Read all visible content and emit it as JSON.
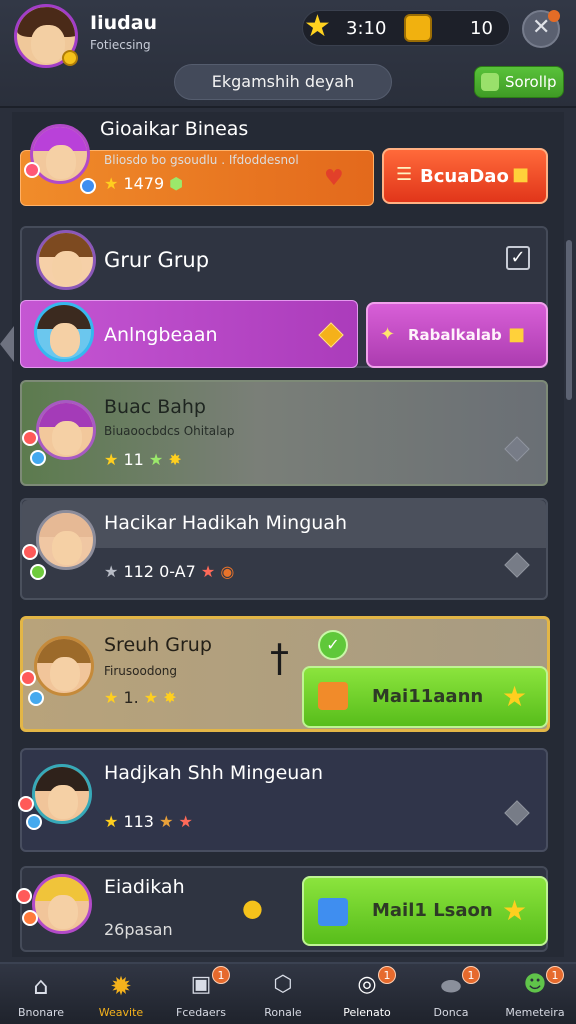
{
  "header": {
    "username": "Iiudau",
    "user_subtitle": "Fotiecsing",
    "stars_count": "3:10",
    "coins_count": "10",
    "search_text": "Ekgamshih deyah",
    "setup_label": "Sorollp"
  },
  "rows": [
    {
      "title": "Gioaikar Bineas",
      "subtitle": "Bliosdo bo gsoudlu . Ifdoddesnol",
      "stat": "1479",
      "action_label": "BcuaDao"
    },
    {
      "title": "Grur Grup",
      "checked": true
    },
    {
      "title": "Anlngbeaan",
      "action_label": "Rabalkalab"
    },
    {
      "title": "Buac Bahp",
      "subtitle": "Biuaoocbdcs Ohitalap",
      "stat": "11"
    },
    {
      "title": "Hacikar Hadikah Minguah",
      "stat": "112 0-A7"
    },
    {
      "title": "Sreuh Grup",
      "subtitle": "Firusoodong",
      "stat": "1.",
      "action_label": "Mai11aann"
    },
    {
      "title": "Hadjkah Shh Mingeuan",
      "stat": "113"
    },
    {
      "title": "Eiadikah",
      "subtitle": "26pasan",
      "action_label": "Mail1 Lsaon"
    }
  ],
  "nav": [
    {
      "label": "Bnonare",
      "icon": "home-icon",
      "badge": ""
    },
    {
      "label": "Weavite",
      "icon": "sun-icon",
      "badge": ""
    },
    {
      "label": "Fcedaers",
      "icon": "camera-icon",
      "badge": "1"
    },
    {
      "label": "Ronale",
      "icon": "shield-icon",
      "badge": ""
    },
    {
      "label": "Pelenato",
      "icon": "compass-icon",
      "badge": "1"
    },
    {
      "label": "Donca",
      "icon": "stone-icon",
      "badge": "1"
    },
    {
      "label": "Memeteira",
      "icon": "character-icon",
      "badge": "1"
    }
  ],
  "colors": {
    "accent_orange": "#e3691c",
    "accent_purple": "#b63ac2",
    "accent_green": "#6fd234",
    "tan_card": "#b8a37b"
  }
}
